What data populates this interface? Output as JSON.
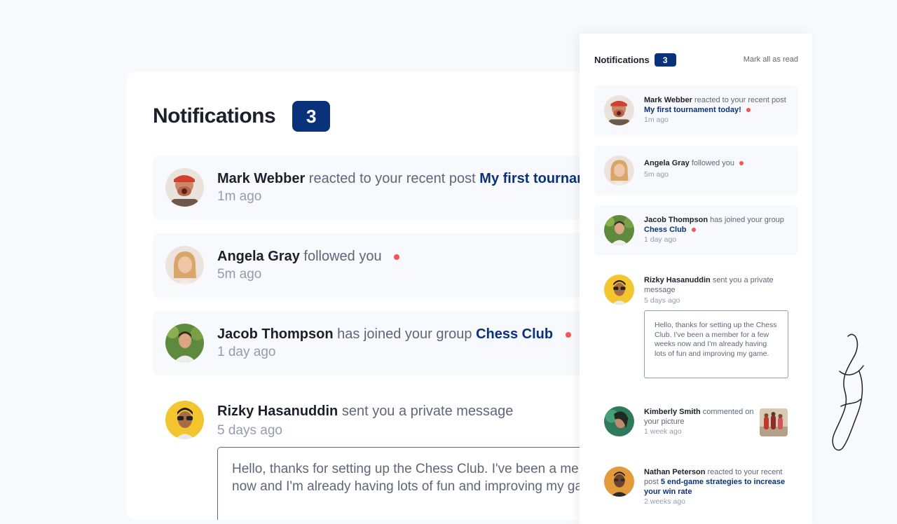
{
  "big": {
    "title": "Notifications",
    "count": "3",
    "items": [
      {
        "name": "Mark Webber",
        "action": "reacted to your recent post",
        "target": "My first tournament today!",
        "time": "1m ago"
      },
      {
        "name": "Angela Gray",
        "action": "followed you",
        "time": "5m ago"
      },
      {
        "name": "Jacob Thompson",
        "action": "has joined your group",
        "target": "Chess Club",
        "time": "1 day ago"
      },
      {
        "name": "Rizky Hasanuddin",
        "action": "sent you a private message",
        "time": "5 days ago",
        "message_line1": "Hello, thanks for setting up the Chess Club. I've been a member for a few weeks",
        "message_line2": "now and I'm already having lots of fun and improving my game."
      }
    ]
  },
  "panel": {
    "title": "Notifications",
    "count": "3",
    "mark_all": "Mark all as read",
    "items": [
      {
        "name": "Mark Webber",
        "action": "reacted to your recent post",
        "target": "My first tournament today!",
        "time": "1m ago"
      },
      {
        "name": "Angela Gray",
        "action": "followed you",
        "time": "5m ago"
      },
      {
        "name": "Jacob Thompson",
        "action": "has joined your group",
        "target": "Chess Club",
        "time": "1 day ago"
      },
      {
        "name": "Rizky Hasanuddin",
        "action": "sent you a private message",
        "time": "5 days ago",
        "message": "Hello, thanks for setting up the Chess Club. I've been a member for a few weeks now and I'm already having lots of fun and improving my game."
      },
      {
        "name": "Kimberly Smith",
        "action": "commented on your picture",
        "time": "1 week ago"
      },
      {
        "name": "Nathan Peterson",
        "action": "reacted to your recent post",
        "target": "5 end-game strategies to increase your win rate",
        "time": "2 weeks ago"
      }
    ]
  },
  "colors": {
    "accent": "#0a327b",
    "unread_dot": "#f65552",
    "unread_bg": "#f7f9fd",
    "text_dark": "#1c202b",
    "text_grey": "#5e6778",
    "text_light": "#939cad"
  }
}
